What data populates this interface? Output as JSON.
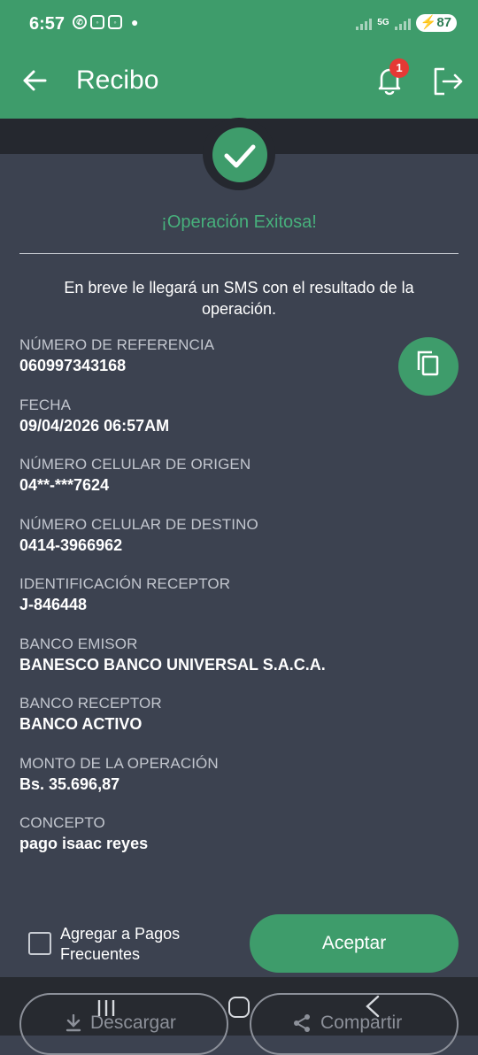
{
  "status_bar": {
    "time": "6:57",
    "app_icons": [
      "whatsapp-icon",
      "instagram-icon",
      "instagram-icon"
    ],
    "network": "5G",
    "battery": "87"
  },
  "app_bar": {
    "title": "Recibo",
    "notification_count": "1"
  },
  "receipt": {
    "success_title": "¡Operación Exitosa!",
    "sms_note": "En breve le llegará un SMS con el resultado de la operación.",
    "fields": [
      {
        "label": "NÚMERO DE REFERENCIA",
        "value": "060997343168"
      },
      {
        "label": "FECHA",
        "value": "09/04/2026 06:57AM"
      },
      {
        "label": "NÚMERO CELULAR DE ORIGEN",
        "value": "04**-***7624"
      },
      {
        "label": "NÚMERO CELULAR DE DESTINO",
        "value": "0414-3966962"
      },
      {
        "label": "IDENTIFICACIÓN RECEPTOR",
        "value": "J-846448"
      },
      {
        "label": "BANCO EMISOR",
        "value": "BANESCO BANCO UNIVERSAL S.A.C.A."
      },
      {
        "label": "BANCO RECEPTOR",
        "value": "BANCO ACTIVO"
      },
      {
        "label": "MONTO DE LA OPERACIÓN",
        "value": "Bs. 35.696,87"
      },
      {
        "label": "CONCEPTO",
        "value": "pago isaac reyes"
      }
    ]
  },
  "actions": {
    "add_frequent_label": "Agregar a Pagos Frecuentes",
    "accept_label": "Aceptar",
    "download_label": "Descargar",
    "share_label": "Compartir"
  },
  "colors": {
    "brand_green": "#3e9c6b",
    "success_text": "#47b07c",
    "background": "#3c4250",
    "badge_red": "#e53935"
  }
}
